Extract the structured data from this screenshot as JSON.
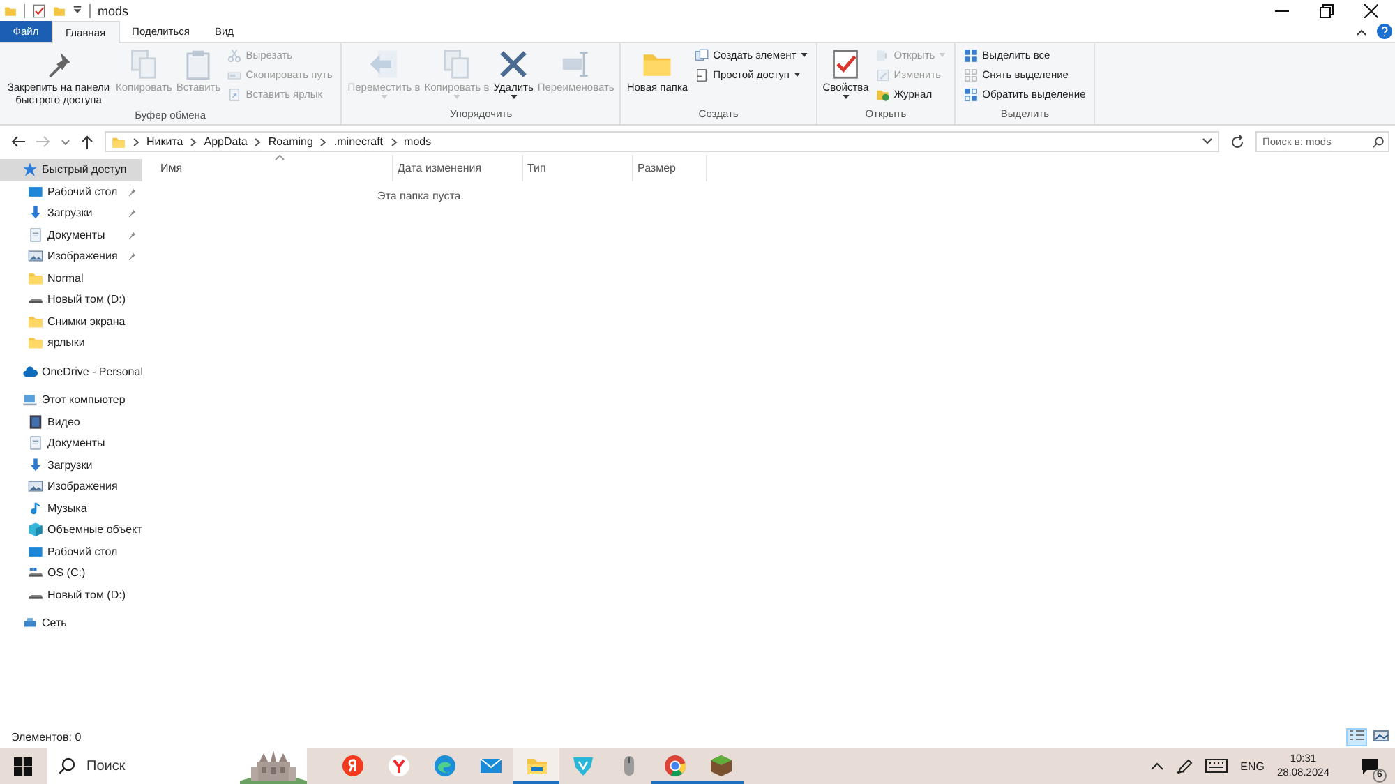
{
  "window": {
    "title": "mods"
  },
  "tabs": [
    {
      "label": "Файл",
      "kind": "file",
      "selected": false
    },
    {
      "label": "Главная",
      "kind": "tab",
      "selected": true
    },
    {
      "label": "Поделиться",
      "kind": "tab",
      "selected": false
    },
    {
      "label": "Вид",
      "kind": "tab",
      "selected": false
    }
  ],
  "ribbon": [
    {
      "label": "Буфер обмена",
      "buttons": [
        {
          "label": "Закрепить на панели быстрого доступа",
          "kind": "pin",
          "large": true,
          "disabled": false,
          "dropdown": false
        },
        {
          "label": "Копировать",
          "kind": "copy",
          "large": true,
          "disabled": true,
          "dropdown": false
        },
        {
          "label": "Вставить",
          "kind": "paste",
          "large": true,
          "disabled": true,
          "dropdown": false
        },
        {
          "label": "Вырезать",
          "kind": "cut",
          "large": false,
          "disabled": true,
          "dropdown": false
        },
        {
          "label": "Скопировать путь",
          "kind": "path",
          "large": false,
          "disabled": true,
          "dropdown": false
        },
        {
          "label": "Вставить ярлык",
          "kind": "shortcut",
          "large": false,
          "disabled": true,
          "dropdown": false
        }
      ]
    },
    {
      "label": "Упорядочить",
      "buttons": [
        {
          "label": "Переместить в",
          "kind": "move",
          "large": true,
          "disabled": true,
          "dropdown": true
        },
        {
          "label": "Копировать в",
          "kind": "copyto",
          "large": true,
          "disabled": true,
          "dropdown": true
        },
        {
          "label": "Удалить",
          "kind": "delete",
          "large": true,
          "disabled": false,
          "dropdown": true
        },
        {
          "label": "Переименовать",
          "kind": "rename",
          "large": true,
          "disabled": true,
          "dropdown": false
        }
      ]
    },
    {
      "label": "Создать",
      "buttons": [
        {
          "label": "Новая папка",
          "kind": "folder",
          "large": true,
          "disabled": false,
          "dropdown": false
        },
        {
          "label": "Создать элемент",
          "kind": "newitem",
          "large": false,
          "disabled": false,
          "dropdown": true
        },
        {
          "label": "Простой доступ",
          "kind": "access",
          "large": false,
          "disabled": false,
          "dropdown": true
        }
      ]
    },
    {
      "label": "Открыть",
      "buttons": [
        {
          "label": "Свойства",
          "kind": "properties",
          "large": true,
          "disabled": false,
          "dropdown": true
        },
        {
          "label": "Открыть",
          "kind": "open",
          "large": false,
          "disabled": true,
          "dropdown": true
        },
        {
          "label": "Изменить",
          "kind": "edit",
          "large": false,
          "disabled": true,
          "dropdown": false
        },
        {
          "label": "Журнал",
          "kind": "history",
          "large": false,
          "disabled": false,
          "dropdown": false
        }
      ]
    },
    {
      "label": "Выделить",
      "buttons": [
        {
          "label": "Выделить все",
          "kind": "selectall",
          "large": false,
          "disabled": false,
          "dropdown": false
        },
        {
          "label": "Снять выделение",
          "kind": "selectnone",
          "large": false,
          "disabled": false,
          "dropdown": false
        },
        {
          "label": "Обратить выделение",
          "kind": "invert",
          "large": false,
          "disabled": false,
          "dropdown": false
        }
      ]
    }
  ],
  "address": {
    "path": [
      "Никита",
      "AppData",
      "Roaming",
      ".minecraft",
      "mods"
    ],
    "search_placeholder": "Поиск в: mods"
  },
  "sidebar": [
    {
      "label": "Быстрый доступ",
      "kind": "star",
      "selected": true,
      "pinned": false,
      "children": [
        {
          "label": "Рабочий стол",
          "kind": "desktop",
          "selected": false,
          "pinned": true
        },
        {
          "label": "Загрузки",
          "kind": "download",
          "selected": false,
          "pinned": true
        },
        {
          "label": "Документы",
          "kind": "document",
          "selected": false,
          "pinned": true
        },
        {
          "label": "Изображения",
          "kind": "pictures",
          "selected": false,
          "pinned": true
        },
        {
          "label": "Normal",
          "kind": "folder",
          "selected": false,
          "pinned": false
        },
        {
          "label": "Новый том (D:)",
          "kind": "drive",
          "selected": false,
          "pinned": false
        },
        {
          "label": "Снимки экрана",
          "kind": "folder",
          "selected": false,
          "pinned": false
        },
        {
          "label": "ярлыки",
          "kind": "folder",
          "selected": false,
          "pinned": false
        }
      ]
    },
    {
      "label": "OneDrive - Personal",
      "kind": "cloud",
      "selected": false,
      "pinned": false
    },
    {
      "label": "Этот компьютер",
      "kind": "computer",
      "selected": false,
      "pinned": false,
      "children": [
        {
          "label": "Видео",
          "kind": "video",
          "selected": false,
          "pinned": false
        },
        {
          "label": "Документы",
          "kind": "document",
          "selected": false,
          "pinned": false
        },
        {
          "label": "Загрузки",
          "kind": "download",
          "selected": false,
          "pinned": false
        },
        {
          "label": "Изображения",
          "kind": "pictures",
          "selected": false,
          "pinned": false
        },
        {
          "label": "Музыка",
          "kind": "music",
          "selected": false,
          "pinned": false
        },
        {
          "label": "Объемные объект",
          "kind": "cube",
          "selected": false,
          "pinned": false
        },
        {
          "label": "Рабочий стол",
          "kind": "desktop",
          "selected": false,
          "pinned": false
        },
        {
          "label": "OS (C:)",
          "kind": "osdrive",
          "selected": false,
          "pinned": false
        },
        {
          "label": "Новый том (D:)",
          "kind": "drive",
          "selected": false,
          "pinned": false
        }
      ]
    },
    {
      "label": "Сеть",
      "kind": "network",
      "selected": false,
      "pinned": false
    }
  ],
  "columns": [
    {
      "label": "Имя",
      "sorted": true
    },
    {
      "label": "Дата изменения",
      "sorted": false
    },
    {
      "label": "Тип",
      "sorted": false
    },
    {
      "label": "Размер",
      "sorted": false
    }
  ],
  "empty_message": "Эта папка пуста.",
  "status_bar": {
    "text": "Элементов: 0",
    "views": [
      {
        "kind": "details",
        "selected": true
      },
      {
        "kind": "tiles",
        "selected": false
      }
    ]
  },
  "taskbar": {
    "search_placeholder": "Поиск",
    "apps": [
      {
        "kind": "letter",
        "running": false,
        "selected": false
      },
      {
        "kind": "ylogo",
        "running": false,
        "selected": false
      },
      {
        "kind": "wave",
        "running": false,
        "selected": false
      },
      {
        "kind": "mail",
        "running": false,
        "selected": false
      },
      {
        "kind": "explorer",
        "running": true,
        "selected": true
      },
      {
        "kind": "shield",
        "running": false,
        "selected": false
      },
      {
        "kind": "mouse",
        "running": false,
        "selected": false
      },
      {
        "kind": "ring",
        "running": true,
        "selected": false
      },
      {
        "kind": "block",
        "running": true,
        "selected": false
      }
    ],
    "language": "ENG",
    "time": "10:31",
    "date": "28.08.2024",
    "notifications": "6"
  }
}
